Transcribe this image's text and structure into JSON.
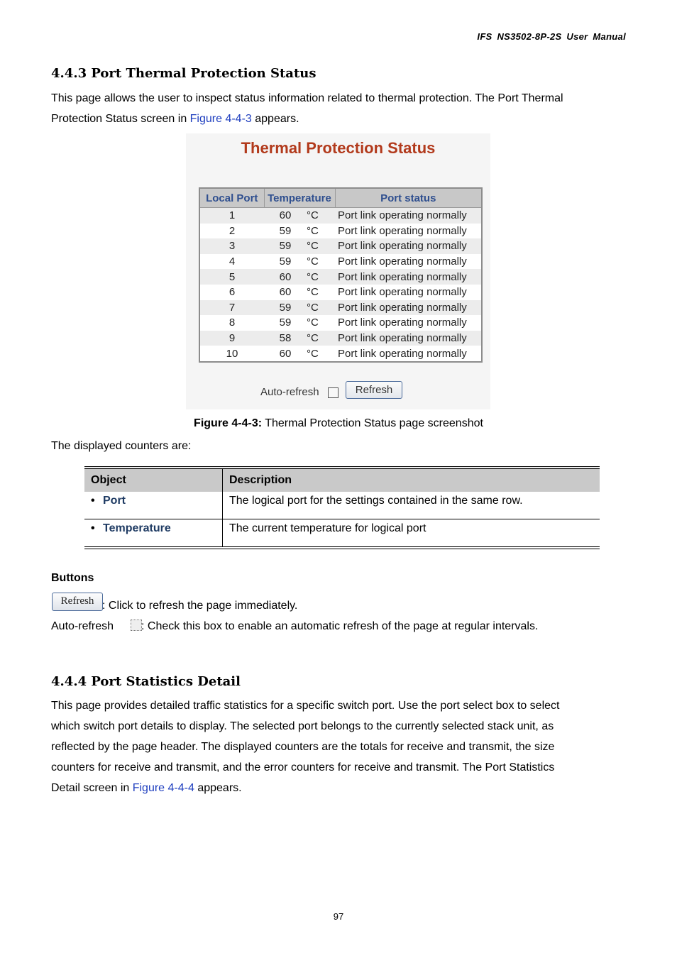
{
  "header": {
    "title": "IFS  NS3502-8P-2S  User  Manual"
  },
  "section1": {
    "heading": "4.4.3 Port Thermal Protection Status",
    "intro_1": "This page allows the user to inspect status information related to thermal protection. The Port Thermal",
    "intro_2_prefix": "Protection Status screen in ",
    "intro_2_link": "Figure 4-4-3",
    "intro_2_suffix": " appears."
  },
  "screenshot": {
    "title": "Thermal Protection Status",
    "columns": [
      "Local Port",
      "Temperature",
      "Port status"
    ],
    "unit": "°C",
    "rows": [
      {
        "port": "1",
        "temp": "60",
        "status": "Port link operating normally"
      },
      {
        "port": "2",
        "temp": "59",
        "status": "Port link operating normally"
      },
      {
        "port": "3",
        "temp": "59",
        "status": "Port link operating normally"
      },
      {
        "port": "4",
        "temp": "59",
        "status": "Port link operating normally"
      },
      {
        "port": "5",
        "temp": "60",
        "status": "Port link operating normally"
      },
      {
        "port": "6",
        "temp": "60",
        "status": "Port link operating normally"
      },
      {
        "port": "7",
        "temp": "59",
        "status": "Port link operating normally"
      },
      {
        "port": "8",
        "temp": "59",
        "status": "Port link operating normally"
      },
      {
        "port": "9",
        "temp": "58",
        "status": "Port link operating normally"
      },
      {
        "port": "10",
        "temp": "60",
        "status": "Port link operating normally"
      }
    ],
    "auto_refresh_label": "Auto-refresh",
    "auto_refresh_checked": false,
    "refresh_label": "Refresh"
  },
  "caption": {
    "label": "Figure 4-4-3:",
    "text": " Thermal Protection Status page screenshot"
  },
  "counters_intro": "The displayed counters are:",
  "desc_table": {
    "headers": [
      "Object",
      "Description"
    ],
    "rows": [
      {
        "object": "Port",
        "description": "The logical port for the settings contained in the same row."
      },
      {
        "object": "Temperature",
        "description": "The current temperature for logical port"
      }
    ]
  },
  "buttons": {
    "heading": "Buttons",
    "refresh_img_label": "Refresh",
    "refresh_desc": ": Click to refresh the page immediately.",
    "auto_refresh_label": "Auto-refresh",
    "auto_refresh_desc": ": Check this box to enable an automatic refresh of the page at regular intervals."
  },
  "section2": {
    "heading": "4.4.4 Port Statistics Detail",
    "body_lines": [
      "This page provides detailed traffic statistics for a specific switch port. Use the port select box to select",
      "which switch port details to display. The selected port belongs to the currently selected stack unit, as",
      "reflected by the page header. The displayed counters are the totals for receive and transmit, the size",
      "counters for receive and transmit, and the error counters for receive and transmit. The Port Statistics"
    ],
    "last_prefix": "Detail screen in ",
    "last_link": "Figure 4-4-4",
    "last_suffix": " appears."
  },
  "page_number": "97"
}
